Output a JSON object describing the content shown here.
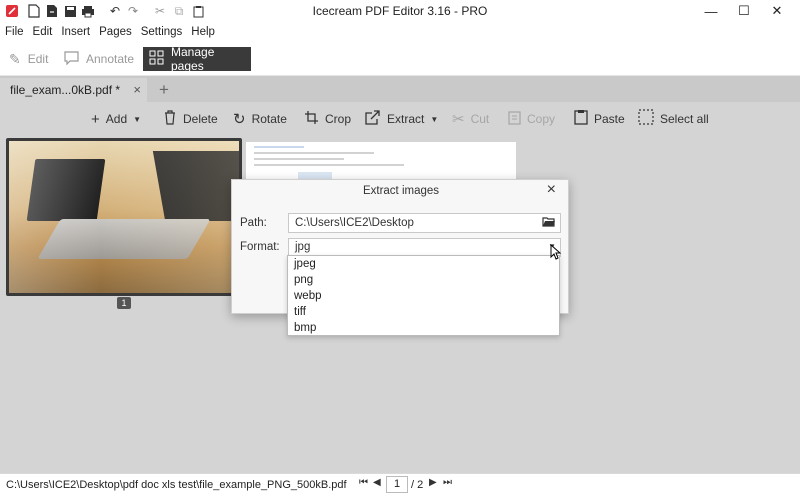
{
  "app": {
    "title": "Icecream PDF Editor 3.16 - PRO",
    "quick_access": [
      "app-logo-icon",
      "new-file-icon",
      "open-file-icon",
      "save-icon",
      "print-icon",
      "undo-icon",
      "redo-icon",
      "cut-icon",
      "copy-icon",
      "paste-icon"
    ],
    "window_controls": {
      "minimize": "—",
      "maximize": "☐",
      "close": "✕"
    }
  },
  "menu": [
    "File",
    "Edit",
    "Insert",
    "Pages",
    "Settings",
    "Help"
  ],
  "modes": {
    "edit": "Edit",
    "annotate": "Annotate",
    "manage_pages": "Manage pages",
    "active": "manage_pages"
  },
  "tabs": {
    "document": "file_exam...0kB.pdf *",
    "close_glyph": "×",
    "add_glyph": "+"
  },
  "toolbar": {
    "add": "Add",
    "delete": "Delete",
    "rotate": "Rotate",
    "crop": "Crop",
    "extract": "Extract",
    "cut": "Cut",
    "copy": "Copy",
    "paste": "Paste",
    "select_all": "Select all"
  },
  "pages": {
    "page1_number": "1"
  },
  "dialog": {
    "title": "Extract images",
    "path_label": "Path:",
    "path_value": "C:\\Users\\ICE2\\Desktop",
    "format_label": "Format:",
    "format_value": "jpg",
    "format_options": [
      "jpeg",
      "png",
      "webp",
      "tiff",
      "bmp"
    ]
  },
  "status": {
    "file_path": "C:\\Users\\ICE2\\Desktop\\pdf doc xls test\\file_example_PNG_500kB.pdf",
    "current_page": "1",
    "total_pages": "/ 2"
  },
  "colors": {
    "active_mode_bg": "#3a3a3a",
    "workspace_bg": "#d4d4d4",
    "tab_strip_bg": "#c9c9c9"
  }
}
